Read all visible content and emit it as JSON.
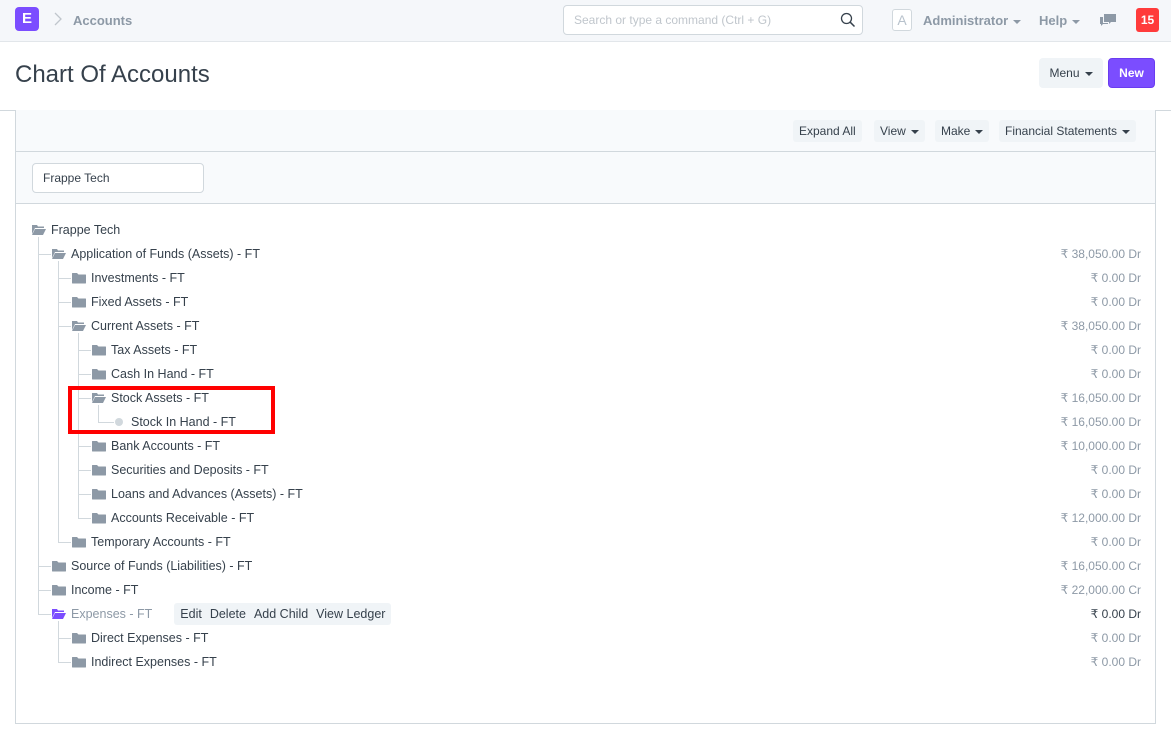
{
  "navbar": {
    "logo_letter": "E",
    "breadcrumb": "Accounts",
    "search_placeholder": "Search or type a command (Ctrl + G)",
    "avatar_letter": "A",
    "user_label": "Administrator",
    "help_label": "Help",
    "notification_count": "15"
  },
  "page": {
    "title": "Chart Of Accounts",
    "menu_label": "Menu",
    "new_label": "New"
  },
  "toolbar": {
    "expand_all": "Expand All",
    "view": "View",
    "make": "Make",
    "financial_statements": "Financial Statements"
  },
  "filter": {
    "company_value": "Frappe Tech"
  },
  "tree": {
    "root": "Frappe Tech",
    "nodes": [
      {
        "label": "Application of Funds (Assets) - FT",
        "balance": "₹ 38,050.00 Dr",
        "level": 1,
        "type": "folder-open"
      },
      {
        "label": "Investments - FT",
        "balance": "₹ 0.00 Dr",
        "level": 2,
        "type": "folder"
      },
      {
        "label": "Fixed Assets - FT",
        "balance": "₹ 0.00 Dr",
        "level": 2,
        "type": "folder"
      },
      {
        "label": "Current Assets - FT",
        "balance": "₹ 38,050.00 Dr",
        "level": 2,
        "type": "folder-open"
      },
      {
        "label": "Tax Assets - FT",
        "balance": "₹ 0.00 Dr",
        "level": 3,
        "type": "folder"
      },
      {
        "label": "Cash In Hand - FT",
        "balance": "₹ 0.00 Dr",
        "level": 3,
        "type": "folder"
      },
      {
        "label": "Stock Assets - FT",
        "balance": "₹ 16,050.00 Dr",
        "level": 3,
        "type": "folder-open"
      },
      {
        "label": "Stock In Hand - FT",
        "balance": "₹ 16,050.00 Dr",
        "level": 4,
        "type": "leaf"
      },
      {
        "label": "Bank Accounts - FT",
        "balance": "₹ 10,000.00 Dr",
        "level": 3,
        "type": "folder"
      },
      {
        "label": "Securities and Deposits - FT",
        "balance": "₹ 0.00 Dr",
        "level": 3,
        "type": "folder"
      },
      {
        "label": "Loans and Advances (Assets) - FT",
        "balance": "₹ 0.00 Dr",
        "level": 3,
        "type": "folder"
      },
      {
        "label": "Accounts Receivable - FT",
        "balance": "₹ 12,000.00 Dr",
        "level": 3,
        "type": "folder"
      },
      {
        "label": "Temporary Accounts - FT",
        "balance": "₹ 0.00 Dr",
        "level": 2,
        "type": "folder"
      },
      {
        "label": "Source of Funds (Liabilities) - FT",
        "balance": "₹ 16,050.00 Cr",
        "level": 1,
        "type": "folder"
      },
      {
        "label": "Income - FT",
        "balance": "₹ 22,000.00 Cr",
        "level": 1,
        "type": "folder"
      },
      {
        "label": "Expenses - FT",
        "balance": "₹ 0.00 Dr",
        "level": 1,
        "type": "folder-open",
        "selected": true
      },
      {
        "label": "Direct Expenses - FT",
        "balance": "₹ 0.00 Dr",
        "level": 2,
        "type": "folder"
      },
      {
        "label": "Indirect Expenses - FT",
        "balance": "₹ 0.00 Dr",
        "level": 2,
        "type": "folder"
      }
    ],
    "node_actions": [
      "Edit",
      "Delete",
      "Add Child",
      "View Ledger"
    ]
  },
  "colors": {
    "brand": "#7b4dff",
    "notification": "#ff3b3b",
    "highlight": "#ff0000",
    "folder": "#8d99a6",
    "selected_folder": "#7b4dff"
  }
}
